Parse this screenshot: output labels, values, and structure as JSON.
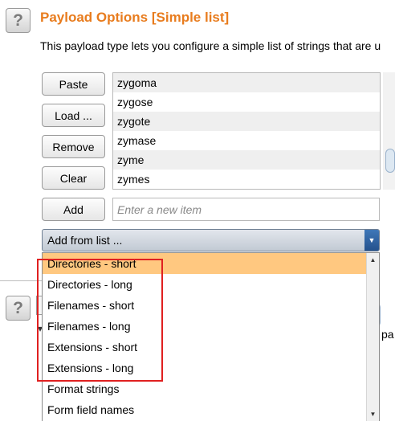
{
  "section": {
    "help_label": "?",
    "title": "Payload Options [Simple list]",
    "description": "This payload type lets you configure a simple list of strings that are u"
  },
  "buttons": {
    "paste": "Paste",
    "load": "Load ...",
    "remove": "Remove",
    "clear": "Clear",
    "add": "Add"
  },
  "payload_list": [
    "zygoma",
    "zygose",
    "zygote",
    "zymase",
    "zyme",
    "zymes"
  ],
  "add_input": {
    "value": "",
    "placeholder": "Enter a new item"
  },
  "add_from_list": {
    "selected": "Add from list ...",
    "options": [
      "Directories - short",
      "Directories - long",
      "Filenames - short",
      "Filenames - long",
      "Extensions - short",
      "Extensions - long",
      "Format strings",
      "Form field names"
    ],
    "highlighted_index": 0
  },
  "lower_section": {
    "help_label": "?",
    "fragment_text": "pa"
  },
  "colors": {
    "title": "#e87c1e",
    "selected_option": "#ffc880",
    "highlight_box": "#e02020",
    "select_arrow": "#2f65a6"
  },
  "icons": {
    "help": "question-mark-icon",
    "dropdown": "chevron-down-icon",
    "scroll_up": "arrow-up-icon",
    "scroll_down": "arrow-down-icon"
  }
}
